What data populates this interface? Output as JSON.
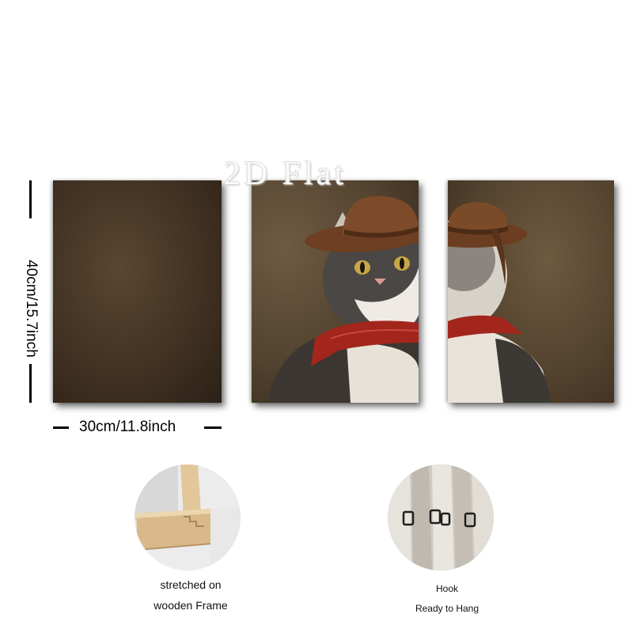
{
  "watermark": "2D Flat",
  "dimensions": {
    "height_label": "40cm/15.7inch",
    "width_label": "30cm/11.8inch"
  },
  "features": [
    {
      "line1": "stretched on",
      "line2": "wooden Frame"
    },
    {
      "line1": "Hook",
      "line2": "Ready to Hang"
    }
  ],
  "colors": {
    "canvas_brown": "#4a3a28",
    "hat_brown": "#7a4a2a",
    "bandana_red": "#a3261c",
    "wood": "#d9b98a"
  }
}
